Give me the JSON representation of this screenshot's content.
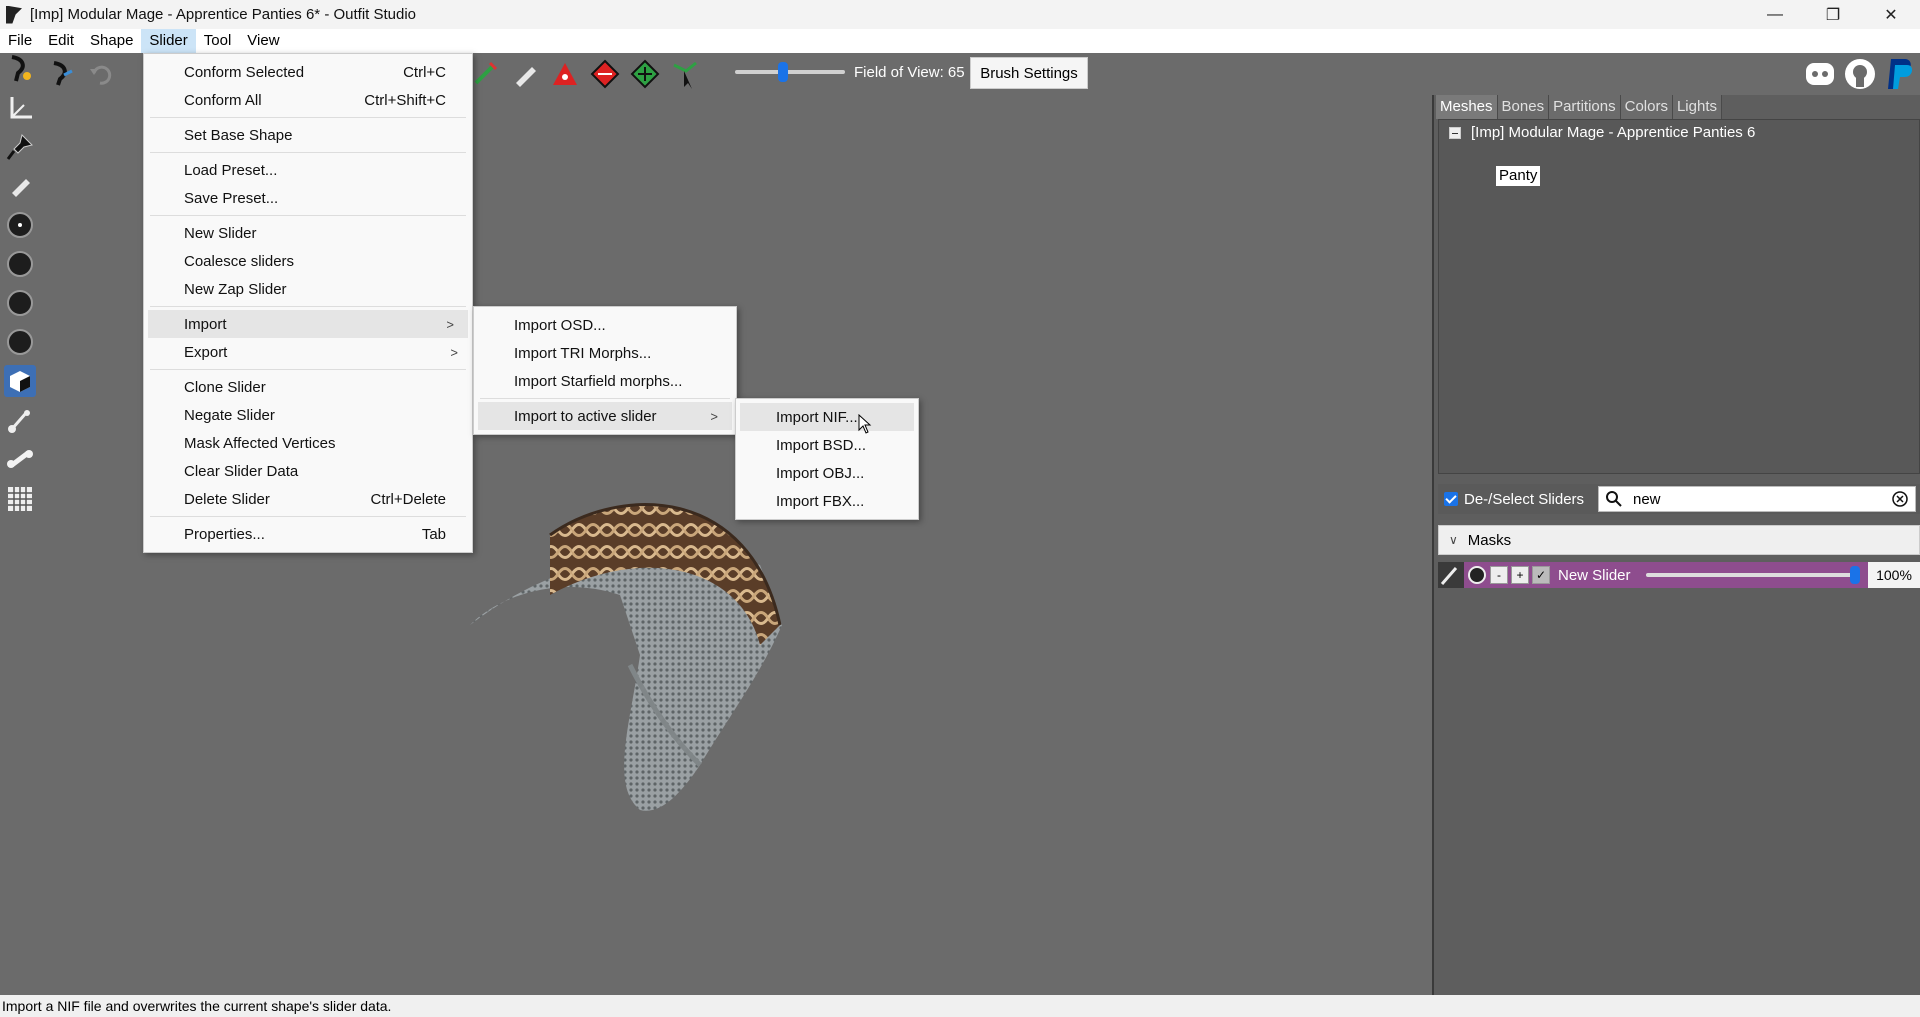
{
  "window": {
    "title": "[Imp] Modular Mage - Apprentice Panties 6* - Outfit Studio",
    "minimize": "—",
    "restore": "❐",
    "close": "✕"
  },
  "menubar": [
    "File",
    "Edit",
    "Shape",
    "Slider",
    "Tool",
    "View"
  ],
  "toolbar": {
    "fov_label": "Field of View: 65",
    "brush_settings": "Brush Settings"
  },
  "slider_menu": {
    "items": [
      {
        "label": "Conform Selected",
        "shortcut": "Ctrl+C"
      },
      {
        "label": "Conform All",
        "shortcut": "Ctrl+Shift+C"
      },
      {
        "label": "Set Base Shape",
        "shortcut": ""
      },
      {
        "label": "Load Preset...",
        "shortcut": ""
      },
      {
        "label": "Save Preset...",
        "shortcut": ""
      },
      {
        "label": "New Slider",
        "shortcut": ""
      },
      {
        "label": "Coalesce sliders",
        "shortcut": ""
      },
      {
        "label": "New Zap Slider",
        "shortcut": ""
      },
      {
        "label": "Import",
        "shortcut": ""
      },
      {
        "label": "Export",
        "shortcut": ""
      },
      {
        "label": "Clone Slider",
        "shortcut": ""
      },
      {
        "label": "Negate Slider",
        "shortcut": ""
      },
      {
        "label": "Mask Affected Vertices",
        "shortcut": ""
      },
      {
        "label": "Clear Slider Data",
        "shortcut": ""
      },
      {
        "label": "Delete Slider",
        "shortcut": "Ctrl+Delete"
      },
      {
        "label": "Properties...",
        "shortcut": "Tab"
      }
    ]
  },
  "import_menu": {
    "items": [
      "Import OSD...",
      "Import TRI Morphs...",
      "Import Starfield morphs...",
      "Import to active slider"
    ]
  },
  "active_slider_menu": {
    "items": [
      "Import NIF...",
      "Import BSD...",
      "Import OBJ...",
      "Import FBX..."
    ]
  },
  "right_panel": {
    "tabs": [
      "Meshes",
      "Bones",
      "Partitions",
      "Colors",
      "Lights"
    ],
    "tree_root": "[Imp] Modular Mage - Apprentice Panties 6",
    "tree_child": "Panty",
    "deselect_label": "De-/Select Sliders",
    "search_value": "new",
    "masks_label": "Masks",
    "slider": {
      "name": "New Slider",
      "value": "100%",
      "minus": "-",
      "plus": "+"
    }
  },
  "statusbar": "Import a NIF file and overwrites the current shape's slider data.",
  "colors": {
    "accent": "#1a73e8",
    "slider_row": "#8e4d8e",
    "viewport": "#6b6b6b"
  }
}
